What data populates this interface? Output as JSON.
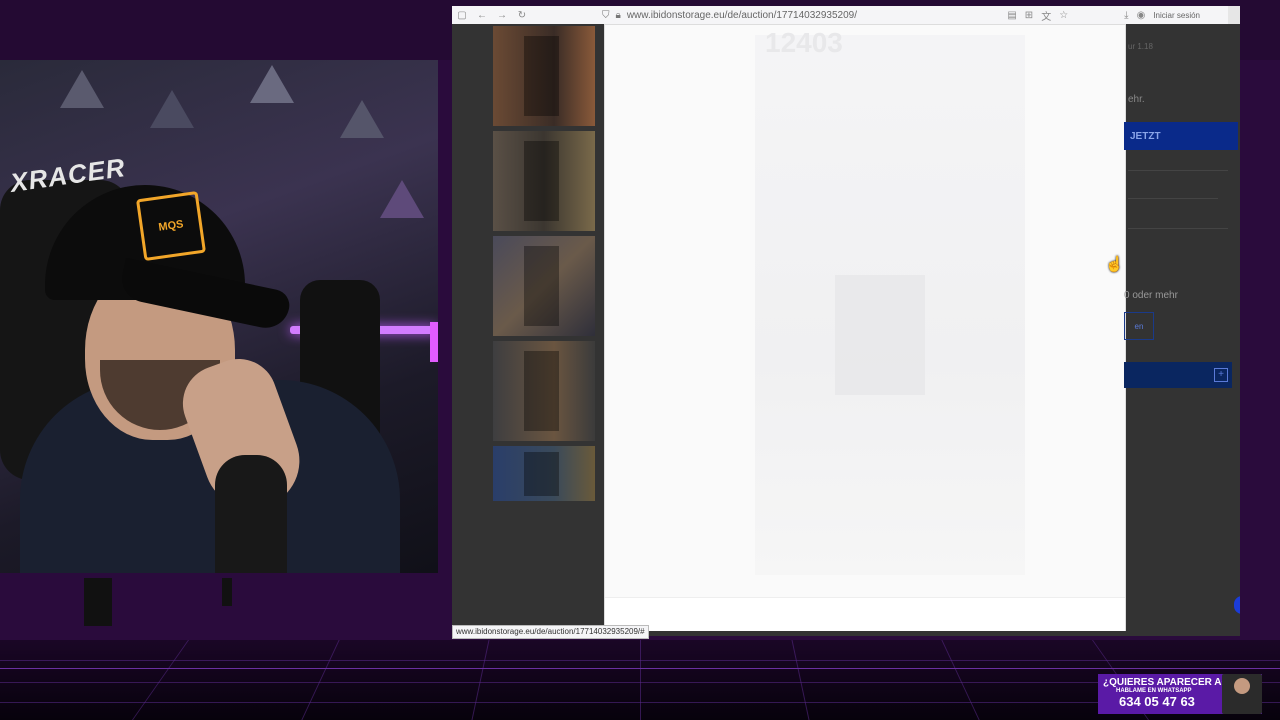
{
  "browser": {
    "url": "www.ibidonstorage.eu/de/auction/17714032935209/",
    "status_url": "www.ibidonstorage.eu/de/auction/17714032935209/#",
    "signin_label": "Iniciar sesión",
    "modal_number": "12403"
  },
  "page_side": {
    "text_top": "ur 1.18",
    "text_mehr": "ehr.",
    "jetzt_label": "JETZT",
    "oder_mehr": "0 oder mehr",
    "small_btn": "en"
  },
  "webcam": {
    "chair_brand": "XRACER",
    "cap_logo": "MQS"
  },
  "promo": {
    "line1": "¿QUIERES APARECER AQUÍ?",
    "line2": "HABLAME EN WHATSAPP",
    "phone": "634 05 47 63"
  },
  "colors": {
    "background": "#2a0b3c",
    "promo": "#5a1aa6",
    "neon": "#d27cff",
    "button_blue": "#0a2a8a"
  }
}
